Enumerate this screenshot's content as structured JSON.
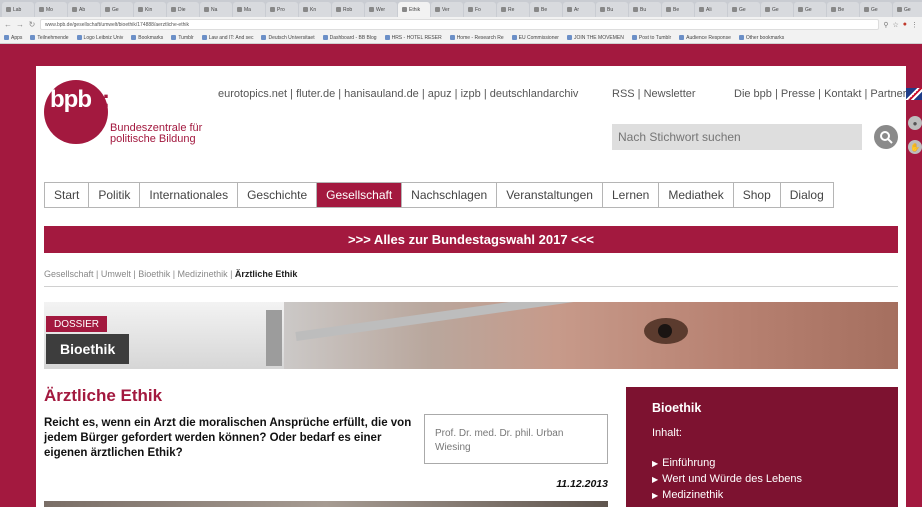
{
  "browser": {
    "tabs": [
      "Lab",
      "Mo",
      "Ab",
      "Ge",
      "Kin",
      "Die",
      "Na",
      "Ma",
      "Pro",
      "Kn",
      "Rob",
      "Wer",
      "Ethik",
      "Ver",
      "Fo",
      "Re",
      "Be",
      "Ar",
      "Bu",
      "Bu",
      "Be",
      "Ali",
      "Ge",
      "Ge",
      "Ge",
      "Be",
      "Ge",
      "Ge",
      "Be"
    ],
    "url": "www.bpb.de/gesellschaft/umwelt/bioethik/174888/aerztliche-ethik",
    "bookmarks": [
      "Apps",
      "Teilnehmende",
      "Logo Leibniz Univ",
      "Bookmarks",
      "Tumblr",
      "Law and IT: And sec",
      "Deutsch Universitaet",
      "Dashboard - BB Blog",
      "HRS - HOTEL RESER",
      "Home - Research Re",
      "EU Commissioner",
      "JOIN THE MOVEMEN",
      "Post to Tumblr",
      "Audience Response",
      "Other bookmarks"
    ]
  },
  "header": {
    "logo_text": "bpb",
    "logo_colon": ":",
    "logo_line1": "Bundeszentrale für",
    "logo_line2": "politische Bildung",
    "partner_links": "eurotopics.net | fluter.de | hanisauland.de | apuz | izpb | deutschlandarchiv",
    "rss_links": "RSS | Newsletter",
    "service_links": "Die bpb | Presse | Kontakt | Partner",
    "search_placeholder": "Nach Stichwort suchen"
  },
  "nav": {
    "items": [
      "Start",
      "Politik",
      "Internationales",
      "Geschichte",
      "Gesellschaft",
      "Nachschlagen",
      "Veranstaltungen",
      "Lernen",
      "Mediathek",
      "Shop",
      "Dialog"
    ],
    "active": "Gesellschaft"
  },
  "banner": {
    "text": ">>> Alles zur Bundestagswahl 2017 <<<"
  },
  "breadcrumb": {
    "trail": "Gesellschaft | Umwelt | Bioethik | Medizinethik | ",
    "current": "Ärztliche Ethik"
  },
  "hero": {
    "tag": "DOSSIER",
    "title": "Bioethik"
  },
  "article": {
    "title": "Ärztliche Ethik",
    "lead": "Reicht es, wenn ein Arzt die moralischen Ansprüche erfüllt, die von jedem Bürger gefordert werden können? Oder bedarf es einer eigenen ärztlichen Ethik?",
    "author": "Prof. Dr. med. Dr. phil. Urban Wiesing",
    "date": "11.12.2013"
  },
  "sidebox": {
    "title": "Bioethik",
    "subtitle": "Inhalt:",
    "items": [
      "Einführung",
      "Wert und Würde des Lebens",
      "Medizinethik"
    ]
  },
  "colors": {
    "brand": "#a3193f",
    "sidebox": "#7d1230",
    "nav_border": "#b5b5b5"
  },
  "icons": [
    "search-icon",
    "back-icon",
    "forward-icon",
    "reload-icon",
    "flag-icon",
    "bullet-triangle-icon"
  ]
}
